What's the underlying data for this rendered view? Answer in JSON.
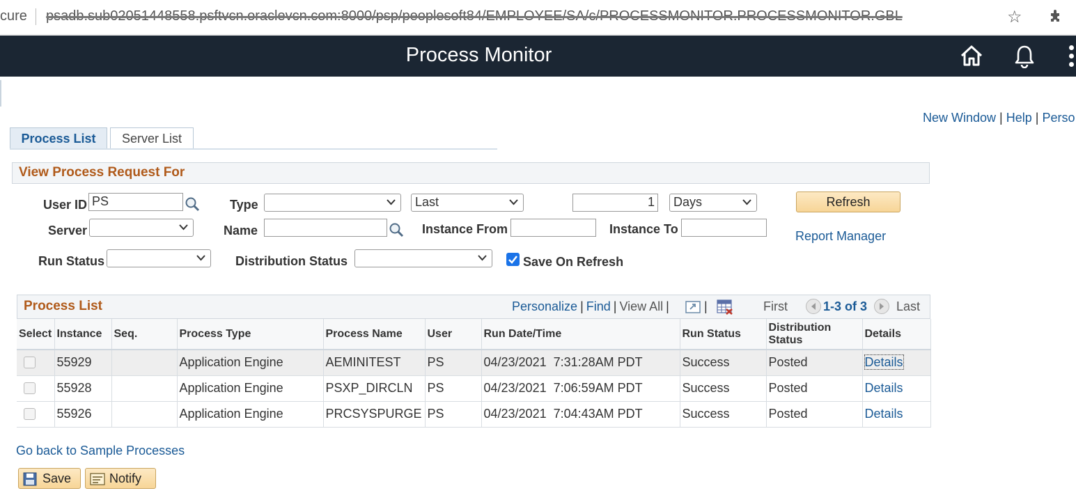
{
  "browser": {
    "secure_text": "cure",
    "url": "psadb.sub02051448558.psftvcn.oraclevcn.com:8000/psp/peoplesoft84/EMPLOYEE/SA/c/PROCESSMONITOR.PROCESSMONITOR.GBL"
  },
  "header": {
    "title": "Process Monitor"
  },
  "top_links": [
    "New Window",
    "Help",
    "Perso"
  ],
  "tabs": [
    {
      "label": "Process List",
      "active": true
    },
    {
      "label": "Server List",
      "active": false
    }
  ],
  "criteria": {
    "section_title": "View Process Request For",
    "user_id_label": "User ID",
    "user_id_value": "PS",
    "type_label": "Type",
    "type_value": "",
    "last_value": "Last",
    "days_count": "1",
    "days_unit": "Days",
    "refresh_label": "Refresh",
    "server_label": "Server",
    "server_value": "",
    "name_label": "Name",
    "name_value": "",
    "instance_from_label": "Instance From",
    "instance_from_value": "",
    "instance_to_label": "Instance To",
    "instance_to_value": "",
    "report_manager_label": "Report Manager",
    "run_status_label": "Run Status",
    "run_status_value": "",
    "dist_status_label": "Distribution Status",
    "dist_status_value": "",
    "save_on_refresh_label": "Save On Refresh",
    "save_on_refresh_checked": true
  },
  "grid": {
    "title": "Process List",
    "personalize": "Personalize",
    "find": "Find",
    "view_all": "View All",
    "first": "First",
    "range": "1-3 of 3",
    "last": "Last",
    "columns": [
      "Select",
      "Instance",
      "Seq.",
      "Process Type",
      "Process Name",
      "User",
      "Run Date/Time",
      "Run Status",
      "Distribution Status",
      "Details"
    ],
    "rows": [
      {
        "instance": "55929",
        "seq": "",
        "process_type": "Application Engine",
        "process_name": "AEMINITEST",
        "user": "PS",
        "run_datetime": "04/23/2021  7:31:28AM PDT",
        "run_status": "Success",
        "dist_status": "Posted",
        "details": "Details"
      },
      {
        "instance": "55928",
        "seq": "",
        "process_type": "Application Engine",
        "process_name": "PSXP_DIRCLN",
        "user": "PS",
        "run_datetime": "04/23/2021  7:06:59AM PDT",
        "run_status": "Success",
        "dist_status": "Posted",
        "details": "Details"
      },
      {
        "instance": "55926",
        "seq": "",
        "process_type": "Application Engine",
        "process_name": "PRCSYSPURGE",
        "user": "PS",
        "run_datetime": "04/23/2021  7:04:43AM PDT",
        "run_status": "Success",
        "dist_status": "Posted",
        "details": "Details"
      }
    ]
  },
  "footer": {
    "back_link": "Go back to Sample Processes",
    "save_label": "Save",
    "notify_label": "Notify"
  },
  "icons": {
    "secure": "lock-icon",
    "star": "bookmark-star-icon",
    "extensions": "puzzle-icon",
    "home": "home-icon",
    "bell": "bell-icon",
    "more": "more-vertical-icon",
    "lookup": "magnifier-icon",
    "zoom": "zoom-grid-icon",
    "download": "download-excel-icon",
    "prev": "prev-arrow-icon",
    "next": "next-arrow-icon",
    "save": "save-disk-icon",
    "notify": "notify-icon"
  },
  "colors": {
    "header_bg": "#1b2633",
    "link": "#1a5a96",
    "section_title": "#b05a1a",
    "button_bg": "#f7d597",
    "checkbox_checked": "#1a73e8"
  }
}
